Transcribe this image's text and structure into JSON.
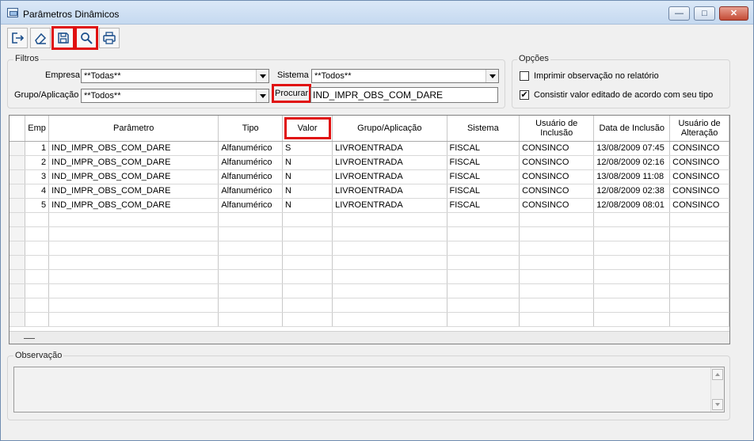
{
  "window": {
    "title": "Parâmetros Dinâmicos",
    "minimize_icon": "minimize-icon",
    "maximize_icon": "maximize-icon",
    "close_icon": "close-icon",
    "min_glyph": "—",
    "max_glyph": "□",
    "close_glyph": "✕"
  },
  "toolbar": {
    "buttons": [
      {
        "icon": "exit-icon",
        "highlighted": false
      },
      {
        "icon": "eraser-icon",
        "highlighted": false
      },
      {
        "icon": "save-icon",
        "highlighted": true
      },
      {
        "icon": "search-icon",
        "highlighted": true
      },
      {
        "icon": "print-icon",
        "highlighted": false
      }
    ],
    "highlight_color": "#e01010"
  },
  "filtros": {
    "title": "Filtros",
    "empresa_label": "Empresa",
    "empresa_value": "**Todas**",
    "sistema_label": "Sistema",
    "sistema_value": "**Todos**",
    "grupo_label": "Grupo/Aplicação",
    "grupo_value": "**Todos**",
    "procurar_label": "Procurar",
    "procurar_value": "IND_IMPR_OBS_COM_DARE"
  },
  "opcoes": {
    "title": "Opções",
    "imprimir_obs_label": "Imprimir observação no relatório",
    "imprimir_obs_checked": false,
    "consistir_label": "Consistir valor editado de acordo com seu tipo",
    "consistir_checked": true,
    "check_glyph": "✔"
  },
  "grid": {
    "columns": [
      "Emp",
      "Parâmetro",
      "Tipo",
      "Valor",
      "Grupo/Aplicação",
      "Sistema",
      "Usuário de Inclusão",
      "Data de Inclusão",
      "Usuário de Alteração"
    ],
    "rows": [
      {
        "emp": "1",
        "parametro": "IND_IMPR_OBS_COM_DARE",
        "tipo": "Alfanumérico",
        "valor": "S",
        "grupo": "LIVROENTRADA",
        "sistema": "FISCAL",
        "usuario_inclusao": "CONSINCO",
        "data_inclusao": "13/08/2009 07:45",
        "usuario_alteracao": "CONSINCO"
      },
      {
        "emp": "2",
        "parametro": "IND_IMPR_OBS_COM_DARE",
        "tipo": "Alfanumérico",
        "valor": "N",
        "grupo": "LIVROENTRADA",
        "sistema": "FISCAL",
        "usuario_inclusao": "CONSINCO",
        "data_inclusao": "12/08/2009 02:16",
        "usuario_alteracao": "CONSINCO"
      },
      {
        "emp": "3",
        "parametro": "IND_IMPR_OBS_COM_DARE",
        "tipo": "Alfanumérico",
        "valor": "N",
        "grupo": "LIVROENTRADA",
        "sistema": "FISCAL",
        "usuario_inclusao": "CONSINCO",
        "data_inclusao": "13/08/2009 11:08",
        "usuario_alteracao": "CONSINCO"
      },
      {
        "emp": "4",
        "parametro": "IND_IMPR_OBS_COM_DARE",
        "tipo": "Alfanumérico",
        "valor": "N",
        "grupo": "LIVROENTRADA",
        "sistema": "FISCAL",
        "usuario_inclusao": "CONSINCO",
        "data_inclusao": "12/08/2009 02:38",
        "usuario_alteracao": "CONSINCO"
      },
      {
        "emp": "5",
        "parametro": "IND_IMPR_OBS_COM_DARE",
        "tipo": "Alfanumérico",
        "valor": "N",
        "grupo": "LIVROENTRADA",
        "sistema": "FISCAL",
        "usuario_inclusao": "CONSINCO",
        "data_inclusao": "12/08/2009 08:01",
        "usuario_alteracao": "CONSINCO"
      }
    ]
  },
  "observacao": {
    "title": "Observação",
    "value": ""
  }
}
